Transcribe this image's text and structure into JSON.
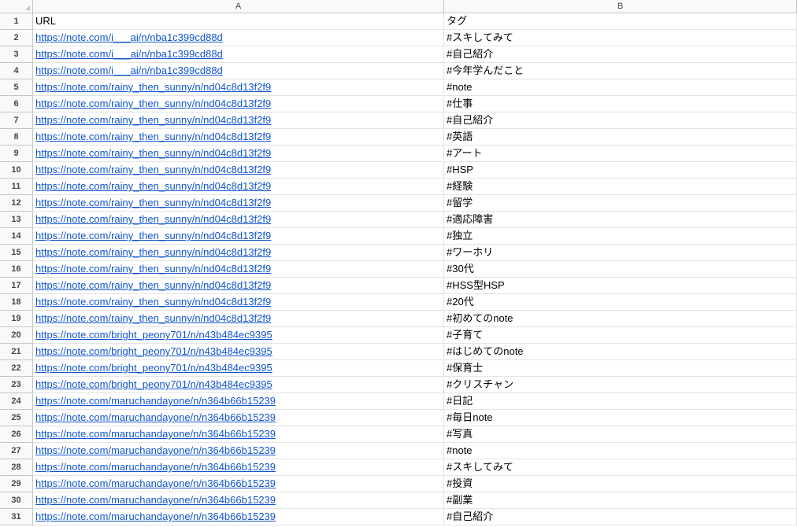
{
  "sheet": {
    "columns": [
      {
        "letter": "A"
      },
      {
        "letter": "B"
      }
    ],
    "rows": [
      {
        "num": "1",
        "a": "URL",
        "b": "タグ"
      },
      {
        "num": "2",
        "a": "https://note.com/i___ai/n/nba1c399cd88d",
        "b": "#スキしてみて"
      },
      {
        "num": "3",
        "a": "https://note.com/i___ai/n/nba1c399cd88d",
        "b": "#自己紹介"
      },
      {
        "num": "4",
        "a": "https://note.com/i___ai/n/nba1c399cd88d",
        "b": "#今年学んだこと"
      },
      {
        "num": "5",
        "a": "https://note.com/rainy_then_sunny/n/nd04c8d13f2f9",
        "b": "#note"
      },
      {
        "num": "6",
        "a": "https://note.com/rainy_then_sunny/n/nd04c8d13f2f9",
        "b": "#仕事"
      },
      {
        "num": "7",
        "a": "https://note.com/rainy_then_sunny/n/nd04c8d13f2f9",
        "b": "#自己紹介"
      },
      {
        "num": "8",
        "a": "https://note.com/rainy_then_sunny/n/nd04c8d13f2f9",
        "b": "#英語"
      },
      {
        "num": "9",
        "a": "https://note.com/rainy_then_sunny/n/nd04c8d13f2f9",
        "b": "#アート"
      },
      {
        "num": "10",
        "a": "https://note.com/rainy_then_sunny/n/nd04c8d13f2f9",
        "b": "#HSP"
      },
      {
        "num": "11",
        "a": "https://note.com/rainy_then_sunny/n/nd04c8d13f2f9",
        "b": "#経験"
      },
      {
        "num": "12",
        "a": "https://note.com/rainy_then_sunny/n/nd04c8d13f2f9",
        "b": "#留学"
      },
      {
        "num": "13",
        "a": "https://note.com/rainy_then_sunny/n/nd04c8d13f2f9",
        "b": "#適応障害"
      },
      {
        "num": "14",
        "a": "https://note.com/rainy_then_sunny/n/nd04c8d13f2f9",
        "b": "#独立"
      },
      {
        "num": "15",
        "a": "https://note.com/rainy_then_sunny/n/nd04c8d13f2f9",
        "b": "#ワーホリ"
      },
      {
        "num": "16",
        "a": "https://note.com/rainy_then_sunny/n/nd04c8d13f2f9",
        "b": "#30代"
      },
      {
        "num": "17",
        "a": "https://note.com/rainy_then_sunny/n/nd04c8d13f2f9",
        "b": "#HSS型HSP"
      },
      {
        "num": "18",
        "a": "https://note.com/rainy_then_sunny/n/nd04c8d13f2f9",
        "b": "#20代"
      },
      {
        "num": "19",
        "a": "https://note.com/rainy_then_sunny/n/nd04c8d13f2f9",
        "b": "#初めてのnote"
      },
      {
        "num": "20",
        "a": "https://note.com/bright_peony701/n/n43b484ec9395",
        "b": "#子育て"
      },
      {
        "num": "21",
        "a": "https://note.com/bright_peony701/n/n43b484ec9395",
        "b": "#はじめてのnote"
      },
      {
        "num": "22",
        "a": "https://note.com/bright_peony701/n/n43b484ec9395",
        "b": "#保育士"
      },
      {
        "num": "23",
        "a": "https://note.com/bright_peony701/n/n43b484ec9395",
        "b": "#クリスチャン"
      },
      {
        "num": "24",
        "a": "https://note.com/maruchandayone/n/n364b66b15239",
        "b": "#日記"
      },
      {
        "num": "25",
        "a": "https://note.com/maruchandayone/n/n364b66b15239",
        "b": "#毎日note"
      },
      {
        "num": "26",
        "a": "https://note.com/maruchandayone/n/n364b66b15239",
        "b": "#写真"
      },
      {
        "num": "27",
        "a": "https://note.com/maruchandayone/n/n364b66b15239",
        "b": "#note"
      },
      {
        "num": "28",
        "a": "https://note.com/maruchandayone/n/n364b66b15239",
        "b": "#スキしてみて"
      },
      {
        "num": "29",
        "a": "https://note.com/maruchandayone/n/n364b66b15239",
        "b": "#投資"
      },
      {
        "num": "30",
        "a": "https://note.com/maruchandayone/n/n364b66b15239",
        "b": "#副業"
      },
      {
        "num": "31",
        "a": "https://note.com/maruchandayone/n/n364b66b15239",
        "b": "#自己紹介"
      }
    ]
  },
  "colors": {
    "link": "#1155cc",
    "header_bg": "#f8f9fa",
    "grid_line": "#e2e3e3"
  }
}
